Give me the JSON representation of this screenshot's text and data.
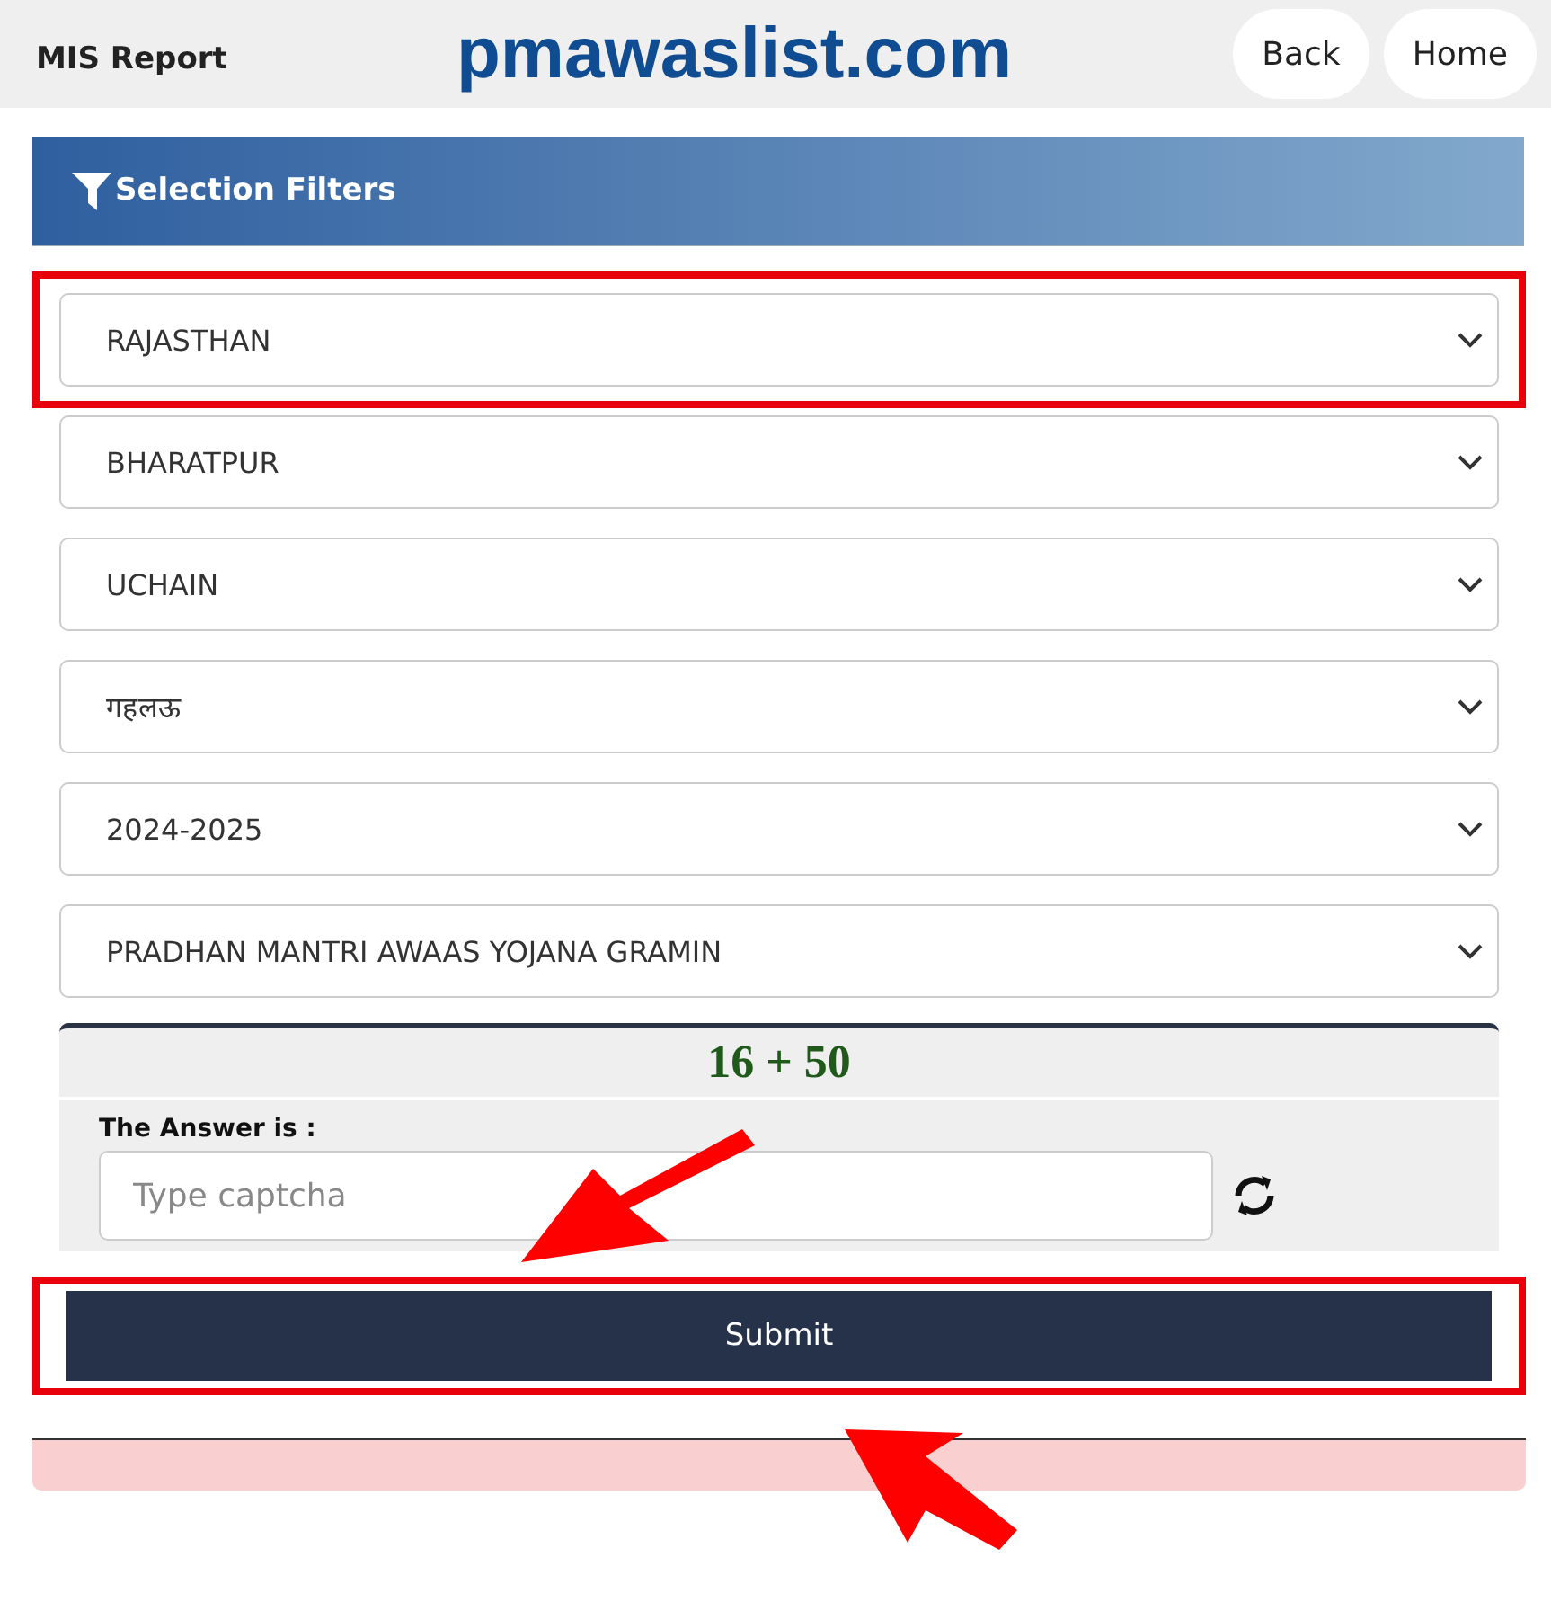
{
  "header": {
    "title": "MIS Report",
    "logo": "pmawaslist.com",
    "buttons": [
      "Back",
      "Home"
    ]
  },
  "filters": {
    "title": "Selection Filters",
    "selects": [
      {
        "value": "RAJASTHAN",
        "highlighted": true
      },
      {
        "value": "BHARATPUR",
        "highlighted": false
      },
      {
        "value": "UCHAIN",
        "highlighted": false
      },
      {
        "value": "गहलऊ",
        "highlighted": false
      },
      {
        "value": "2024-2025",
        "highlighted": false
      },
      {
        "value": "PRADHAN MANTRI AWAAS YOJANA GRAMIN",
        "highlighted": false
      }
    ]
  },
  "captcha": {
    "question": "16 + 50",
    "label": "The Answer is :",
    "placeholder": "Type captcha"
  },
  "submit": {
    "label": "Submit",
    "highlighted": true
  }
}
